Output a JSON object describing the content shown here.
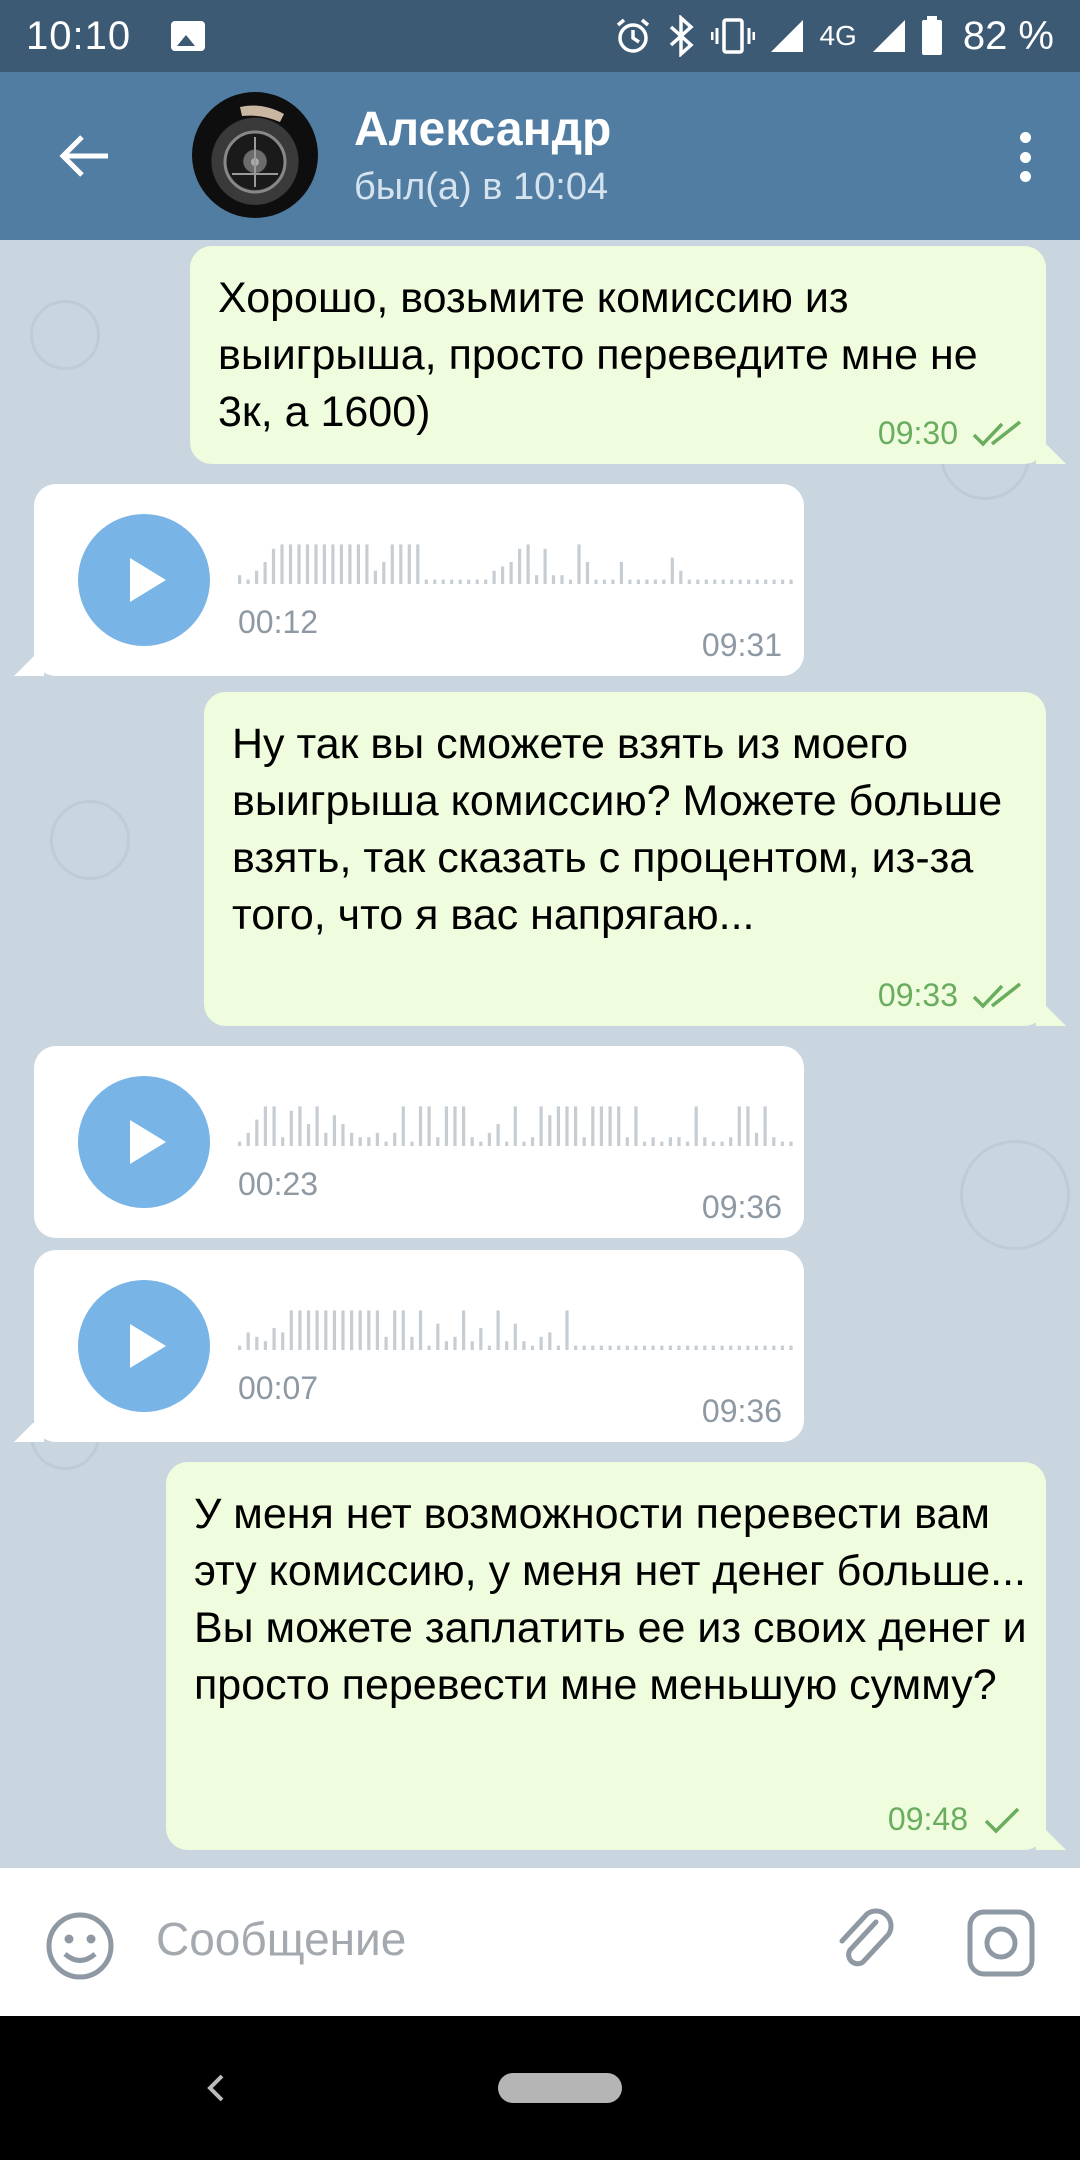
{
  "status_bar": {
    "time": "10:10",
    "network": "4G",
    "battery": "82 %",
    "icons": [
      "gallery-icon",
      "alarm-icon",
      "bluetooth-icon",
      "vibrate-icon",
      "signal-icon",
      "battery-icon"
    ]
  },
  "header": {
    "contact_name": "Александр",
    "last_seen": "был(а) в 10:04",
    "icons": [
      "back-arrow-icon",
      "avatar",
      "more-vertical-icon"
    ]
  },
  "messages": [
    {
      "type": "text",
      "direction": "outgoing",
      "text": "Хорошо, возьмите комиссию из выигрыша, просто переведите мне не 3к, а 1600)",
      "time": "09:30",
      "status": "read"
    },
    {
      "type": "voice",
      "direction": "incoming",
      "duration": "00:12",
      "time": "09:31",
      "waveform": [
        0.2,
        0.1,
        0.3,
        0.5,
        0.8,
        0.9,
        0.9,
        0.9,
        0.9,
        0.9,
        0.9,
        0.9,
        0.9,
        0.9,
        0.9,
        0.9,
        0.3,
        0.5,
        0.9,
        0.9,
        0.9,
        0.9,
        0.1,
        0.1,
        0.1,
        0.1,
        0.1,
        0.1,
        0.1,
        0.1,
        0.3,
        0.4,
        0.5,
        0.8,
        0.9,
        0.2,
        0.8,
        0.2,
        0.2,
        0.1,
        0.9,
        0.5,
        0.1,
        0.1,
        0.1,
        0.5,
        0.1,
        0.1,
        0.1,
        0.1,
        0.1,
        0.6,
        0.3,
        0.1,
        0.1,
        0.1,
        0.1,
        0.1,
        0.1,
        0.1,
        0.1,
        0.1,
        0.1,
        0.1,
        0.1,
        0.1
      ]
    },
    {
      "type": "text",
      "direction": "outgoing",
      "text": "Ну так вы сможете взять из моего выигрыша комиссию? Можете больше взять, так сказать с процентом, из-за того, что я вас напрягаю...",
      "time": "09:33",
      "status": "read"
    },
    {
      "type": "voice",
      "direction": "incoming",
      "duration": "00:23",
      "time": "09:36",
      "waveform": [
        0.1,
        0.3,
        0.6,
        0.9,
        0.9,
        0.2,
        0.8,
        0.9,
        0.5,
        0.9,
        0.3,
        0.7,
        0.5,
        0.3,
        0.2,
        0.2,
        0.3,
        0.1,
        0.3,
        0.9,
        0.1,
        0.9,
        0.9,
        0.2,
        0.9,
        0.9,
        0.9,
        0.2,
        0.1,
        0.3,
        0.5,
        0.1,
        0.9,
        0.1,
        0.2,
        0.9,
        0.7,
        0.9,
        0.9,
        0.9,
        0.2,
        0.9,
        0.9,
        0.9,
        0.9,
        0.2,
        0.9,
        0.1,
        0.2,
        0.1,
        0.2,
        0.2,
        0.1,
        0.9,
        0.2,
        0.1,
        0.1,
        0.2,
        0.9,
        0.9,
        0.3,
        0.9,
        0.2,
        0.1,
        0.1
      ]
    },
    {
      "type": "voice",
      "direction": "incoming",
      "duration": "00:07",
      "time": "09:36",
      "waveform": [
        0.1,
        0.4,
        0.3,
        0.2,
        0.5,
        0.4,
        0.9,
        0.9,
        0.9,
        0.9,
        0.9,
        0.9,
        0.9,
        0.9,
        0.9,
        0.9,
        0.9,
        0.3,
        0.9,
        0.9,
        0.3,
        0.9,
        0.1,
        0.6,
        0.2,
        0.3,
        0.9,
        0.2,
        0.5,
        0.1,
        0.9,
        0.2,
        0.6,
        0.2,
        0.1,
        0.3,
        0.4,
        0.1,
        0.9,
        0.1,
        0.1,
        0.1,
        0.1,
        0.1,
        0.1,
        0.1,
        0.1,
        0.1,
        0.1,
        0.1,
        0.1,
        0.1,
        0.1,
        0.1,
        0.1,
        0.1,
        0.1,
        0.1,
        0.1,
        0.1,
        0.1,
        0.1,
        0.1,
        0.1,
        0.1
      ]
    },
    {
      "type": "text",
      "direction": "outgoing",
      "text": "У меня нет возможности перевести вам эту комиссию, у меня нет денег больше...\nВы можете заплатить ее из своих денег и просто перевести мне меньшую сумму?",
      "time": "09:48",
      "status": "sent"
    }
  ],
  "input_bar": {
    "placeholder": "Сообщение",
    "icons": [
      "emoji-icon",
      "attach-icon",
      "camera-icon"
    ]
  },
  "nav_bar": {
    "icons": [
      "nav-back-icon",
      "nav-home-pill"
    ]
  },
  "colors": {
    "status_bar_bg": "#3d5a75",
    "app_bar_bg": "#517da2",
    "chat_bg": "#cad6df",
    "outgoing_bubble": "#effdde",
    "incoming_bubble": "#ffffff",
    "outgoing_time": "#6aad5e",
    "play_button": "#78b5e6"
  }
}
